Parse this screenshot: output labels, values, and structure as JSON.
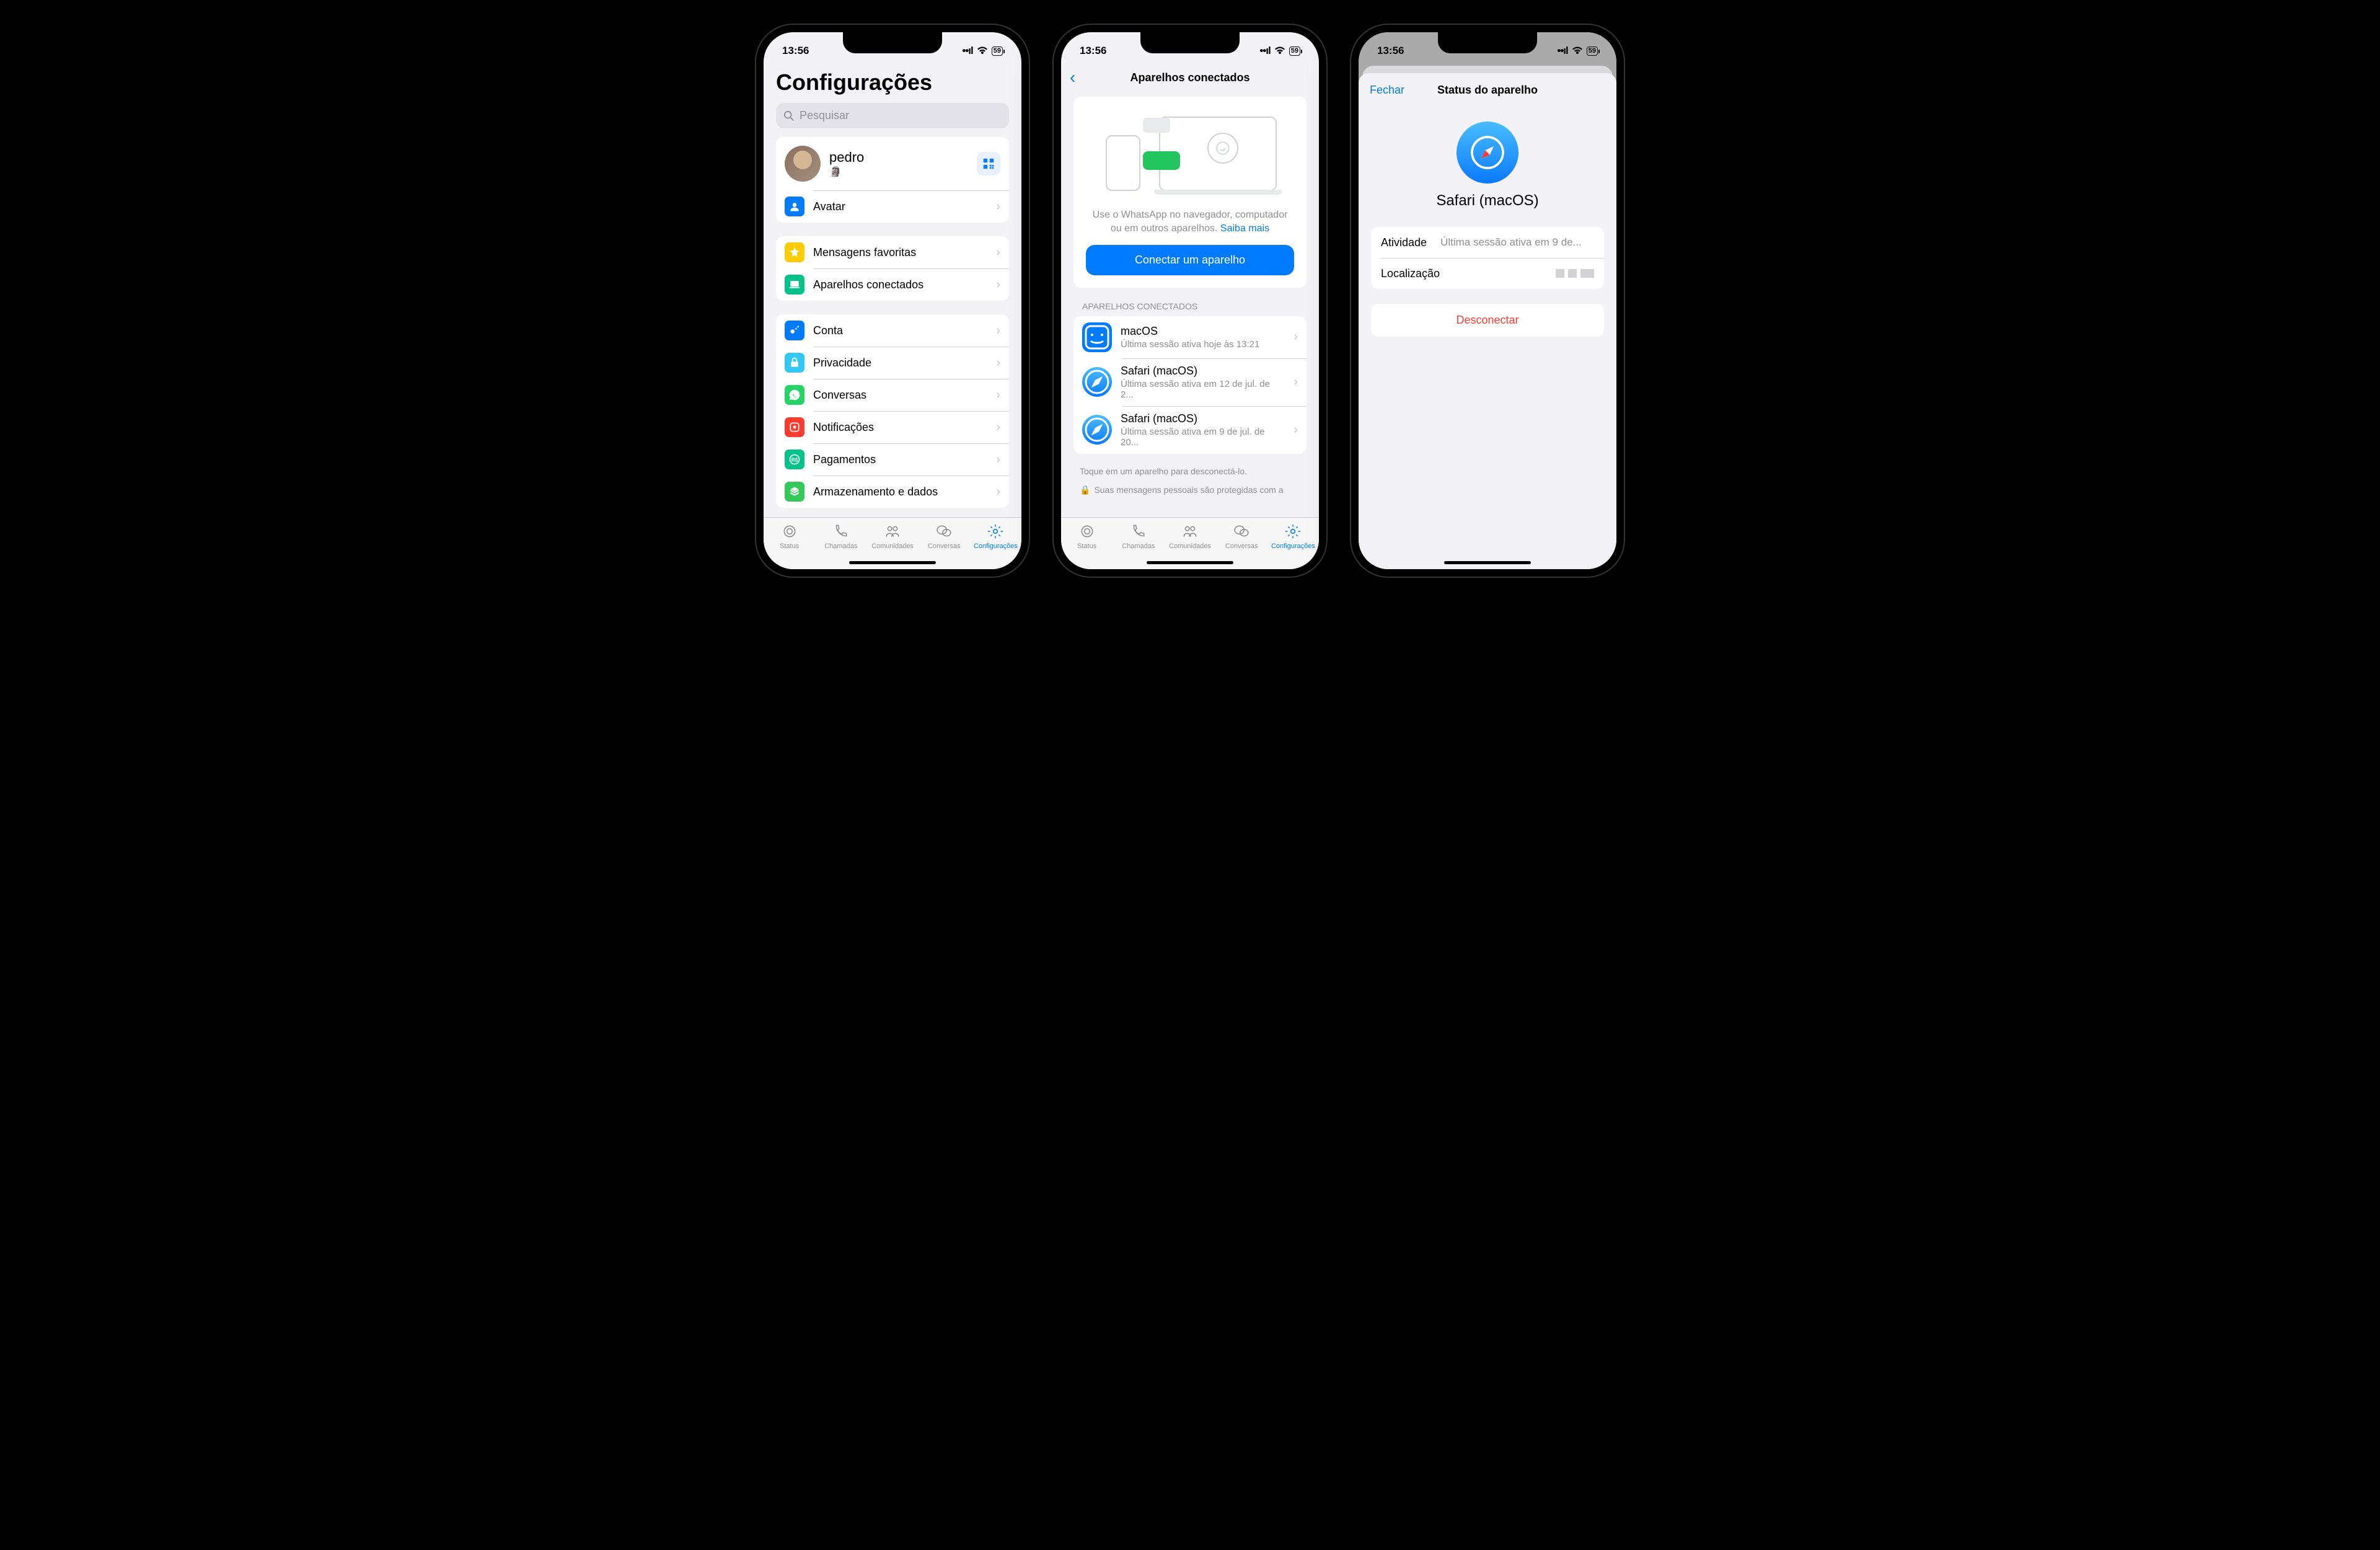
{
  "status": {
    "time": "13:56",
    "battery": "59"
  },
  "tabs": [
    {
      "label": "Status"
    },
    {
      "label": "Chamadas"
    },
    {
      "label": "Comunidades"
    },
    {
      "label": "Conversas"
    },
    {
      "label": "Configurações"
    }
  ],
  "screen1": {
    "title": "Configurações",
    "search_placeholder": "Pesquisar",
    "profile_name": "pedro",
    "profile_status": "🗿",
    "avatar_label": "Avatar",
    "group1": [
      {
        "label": "Mensagens favoritas",
        "color": "#ffcc00",
        "icon": "star"
      },
      {
        "label": "Aparelhos conectados",
        "color": "#00c389",
        "icon": "laptop"
      }
    ],
    "group2": [
      {
        "label": "Conta",
        "color": "#007aff",
        "icon": "key"
      },
      {
        "label": "Privacidade",
        "color": "#32c8f5",
        "icon": "lock"
      },
      {
        "label": "Conversas",
        "color": "#25d366",
        "icon": "whatsapp"
      },
      {
        "label": "Notificações",
        "color": "#ff3b30",
        "icon": "bell"
      },
      {
        "label": "Pagamentos",
        "color": "#00c389",
        "icon": "payments"
      },
      {
        "label": "Armazenamento e dados",
        "color": "#34c759",
        "icon": "storage"
      }
    ]
  },
  "screen2": {
    "title": "Aparelhos conectados",
    "hero_text_1": "Use o WhatsApp no navegador, computador ou em outros aparelhos. ",
    "hero_link": "Saiba mais",
    "cta": "Conectar um aparelho",
    "section_header": "APARELHOS CONECTADOS",
    "devices": [
      {
        "name": "macOS",
        "sub": "Última sessão ativa hoje às 13:21",
        "icon": "finder",
        "bg": "#007aff"
      },
      {
        "name": "Safari (macOS)",
        "sub": "Última sessão ativa em 12 de jul. de 2...",
        "icon": "safari",
        "bg": "grad"
      },
      {
        "name": "Safari (macOS)",
        "sub": "Última sessão ativa em 9 de jul. de 20...",
        "icon": "safari",
        "bg": "grad"
      }
    ],
    "footer1": "Toque em um aparelho para desconectá-lo.",
    "footer2": "Suas mensagens pessoais são protegidas com a"
  },
  "screen3": {
    "close": "Fechar",
    "title": "Status do aparelho",
    "device_name": "Safari (macOS)",
    "activity_label": "Atividade",
    "activity_value": "Última sessão ativa em 9 de...",
    "location_label": "Localização",
    "disconnect": "Desconectar"
  }
}
